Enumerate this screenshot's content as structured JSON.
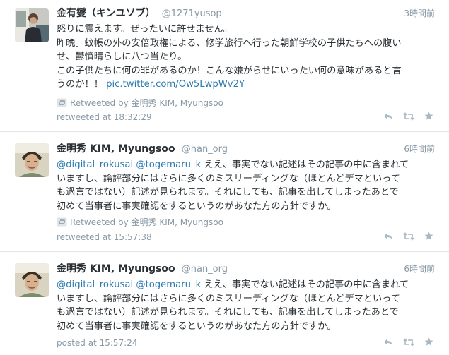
{
  "tweets": [
    {
      "name": "金有燮（キンユソブ）",
      "handle": "@1271yusop",
      "time": "3時間前",
      "lines": [
        "怒りに震えます。ぜったいに許せません。",
        "昨晩。蚊帳の外の安倍政権による、修学旅行へ行った朝鮮学校の子供たちへの腹い",
        "せ、鬱憤晴らしに八つ当たり。",
        "この子供たちに何の罪があるのか！こんな嫌がらせにいったい何の意味があると言",
        "うのか！！"
      ],
      "link": "pic.twitter.com/Ow5LwpWv2Y",
      "rt_label": "Retweeted by 金明秀 KIM, Myungsoo",
      "footer": "retweeted at 18:32:29"
    },
    {
      "name": "金明秀 KIM, Myungsoo",
      "handle": "@han_org",
      "time": "6時間前",
      "mention1": "@digital_rokusai",
      "mention2": "@togemaru_k",
      "first_line_rest": " ええ、事実でない記述はその記事の中に含まれて",
      "lines": [
        "いますし、論評部分にはさらに多くのミスリーディングな（ほとんどデマといって",
        "も過言ではない）記述が見られます。それにしても、記事を出してしまったあとで",
        "初めて当事者に事実確認をするというのがあなた方の方針ですか。"
      ],
      "rt_label": "Retweeted by 金明秀 KIM, Myungsoo",
      "footer": "retweeted at 15:57:38"
    },
    {
      "name": "金明秀 KIM, Myungsoo",
      "handle": "@han_org",
      "time": "6時間前",
      "mention1": "@digital_rokusai",
      "mention2": "@togemaru_k",
      "first_line_rest": " ええ、事実でない記述はその記事の中に含まれて",
      "lines": [
        "いますし、論評部分にはさらに多くのミスリーディングな（ほとんどデマといって",
        "も過言ではない）記述が見られます。それにしても、記事を出してしまったあとで",
        "初めて当事者に事実確認をするというのがあなた方の方針ですか。"
      ],
      "footer": "posted at 15:57:24"
    }
  ],
  "colors": {
    "link": "#2a7ab0",
    "meta": "#8899a6",
    "text": "#292f33"
  },
  "icons": [
    "retweet-icon",
    "reply-icon",
    "favorite-icon"
  ]
}
